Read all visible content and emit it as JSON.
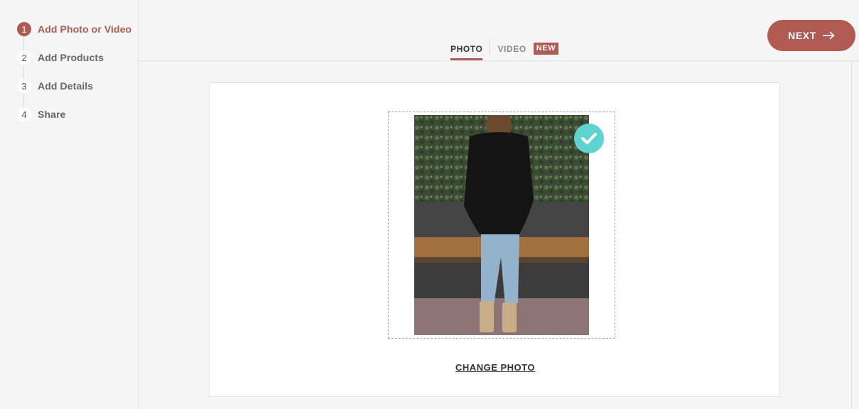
{
  "steps": [
    {
      "num": "1",
      "label": "Add Photo or Video",
      "active": true
    },
    {
      "num": "2",
      "label": "Add Products",
      "active": false
    },
    {
      "num": "3",
      "label": "Add Details",
      "active": false
    },
    {
      "num": "4",
      "label": "Share",
      "active": false
    }
  ],
  "tabs": {
    "photo": "PHOTO",
    "video": "VIDEO",
    "new_badge": "NEW"
  },
  "next_button": {
    "label": "NEXT"
  },
  "upload": {
    "change_label": "CHANGE PHOTO",
    "selected": true
  },
  "colors": {
    "accent": "#b05a52",
    "check": "#5ed3d0"
  }
}
